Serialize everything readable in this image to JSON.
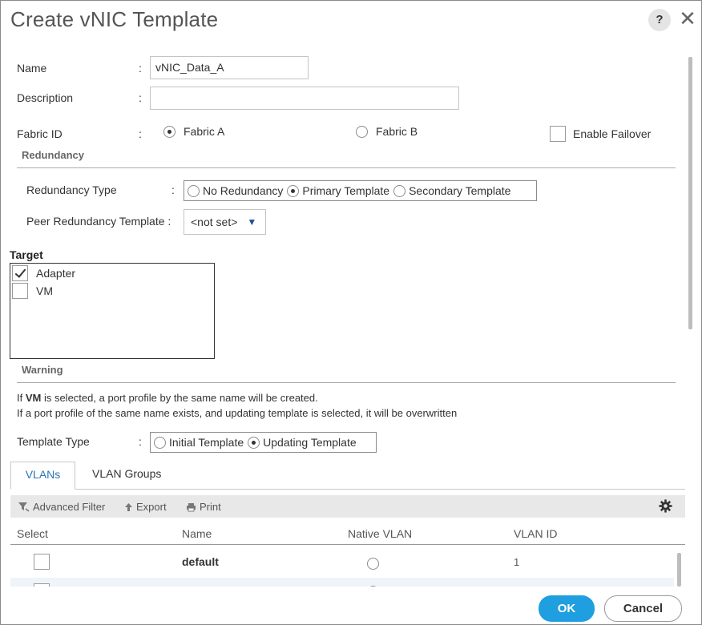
{
  "dialog": {
    "title": "Create vNIC Template",
    "help_label": "?",
    "close_label": "✕"
  },
  "form": {
    "name_label": "Name",
    "name_value": "vNIC_Data_A",
    "colon": ":",
    "description_label": "Description",
    "description_value": "",
    "fabric_id_label": "Fabric ID",
    "fabric_a_label": "Fabric A",
    "fabric_b_label": "Fabric B",
    "fabric_selected": "Fabric A",
    "enable_failover_label": "Enable Failover",
    "enable_failover_checked": false
  },
  "redundancy": {
    "heading": "Redundancy",
    "type_label": "Redundancy Type",
    "options": [
      "No Redundancy",
      "Primary Template",
      "Secondary Template"
    ],
    "selected": "Primary Template",
    "peer_label": "Peer Redundancy Template :",
    "peer_value": "<not set>",
    "caret": "▼"
  },
  "target": {
    "heading": "Target",
    "items": [
      {
        "label": "Adapter",
        "checked": true
      },
      {
        "label": "VM",
        "checked": false
      }
    ]
  },
  "warning": {
    "heading": "Warning",
    "line1_prefix": "If ",
    "line1_bold": "VM",
    "line1_suffix": " is selected, a port profile by the same name will be created.",
    "line2": "If a port profile of the same name exists, and updating template is selected, it will be overwritten"
  },
  "template_type": {
    "label": "Template Type",
    "options": [
      "Initial Template",
      "Updating Template"
    ],
    "selected": "Updating Template"
  },
  "tabs": [
    {
      "label": "VLANs",
      "active": true
    },
    {
      "label": "VLAN Groups",
      "active": false
    }
  ],
  "toolbar": {
    "advanced_filter": "Advanced Filter",
    "export": "Export",
    "print": "Print"
  },
  "table": {
    "columns": [
      "Select",
      "Name",
      "Native VLAN",
      "VLAN ID"
    ],
    "rows": [
      {
        "name": "default",
        "vlan_id": "1",
        "selected": false,
        "native": false
      },
      {
        "name": "",
        "vlan_id": "",
        "selected": false,
        "native": false
      }
    ]
  },
  "footer": {
    "ok_label": "OK",
    "cancel_label": "Cancel"
  },
  "colors": {
    "accent": "#1f9ee0",
    "tab_active_text": "#2a74b8",
    "border": "#8a8a8a"
  }
}
